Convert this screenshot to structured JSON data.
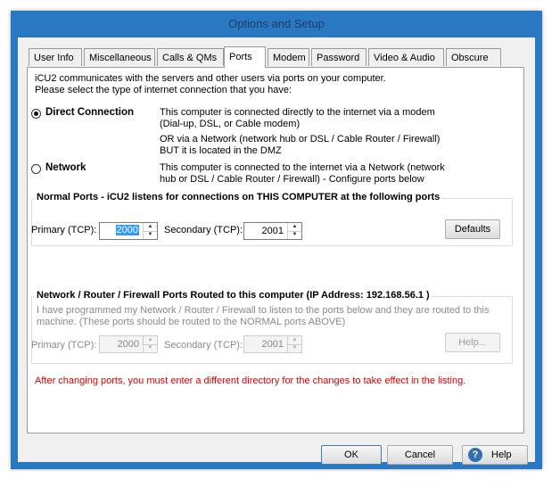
{
  "window": {
    "title": "Options and Setup"
  },
  "tabs": [
    {
      "label": "User Info"
    },
    {
      "label": "Miscellaneous"
    },
    {
      "label": "Calls & QMs"
    },
    {
      "label": "Ports",
      "active": true
    },
    {
      "label": "Modem"
    },
    {
      "label": "Password"
    },
    {
      "label": "Video & Audio"
    },
    {
      "label": "Obscure"
    }
  ],
  "intro": {
    "line1": "iCU2 communicates with the servers and other users via ports on your computer.",
    "line2": "Please select the type of internet connection that you have:"
  },
  "connection": {
    "direct": {
      "label": "Direct Connection",
      "selected": true,
      "desc": [
        "This computer is connected directly to the internet via a modem",
        "(Dial-up, DSL, or Cable modem)",
        "OR via a Network (network hub or DSL / Cable Router / Firewall)",
        "BUT it is located in the DMZ"
      ]
    },
    "network": {
      "label": "Network",
      "selected": false,
      "desc": [
        "This computer is connected to the internet via a Network (network",
        "hub or DSL / Cable Router / Firewall) - Configure ports below"
      ]
    }
  },
  "normal_ports": {
    "title": "Normal Ports - iCU2 listens for connections on THIS COMPUTER at the following ports",
    "primary_label": "Primary (TCP):",
    "primary_value": "2000",
    "secondary_label": "Secondary (TCP):",
    "secondary_value": "2001",
    "defaults_button": "Defaults"
  },
  "routed_ports": {
    "title": "Network / Router / Firewall Ports Routed to this computer (IP Address: 192.168.56.1 )",
    "note1": "I have programmed my Network / Router / Firewall to listen to the ports below and they are routed to this",
    "note2": "machine. (These ports should be routed to the NORMAL ports ABOVE)",
    "primary_label": "Primary (TCP):",
    "primary_value": "2000",
    "secondary_label": "Secondary (TCP):",
    "secondary_value": "2001",
    "help_button": "Help..."
  },
  "warning": "After changing ports, you must enter a different directory for the changes to take effect in the listing.",
  "footer": {
    "ok": "OK",
    "cancel": "Cancel",
    "help": "Help"
  },
  "colors": {
    "frame": "#2b78c2",
    "selection": "#3399ff",
    "warning": "#e00000"
  }
}
